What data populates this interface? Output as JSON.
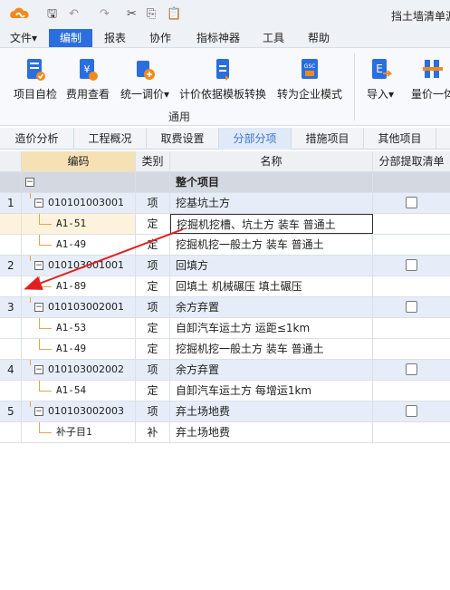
{
  "window": {
    "title": "挡土墙清单源"
  },
  "quick_access": {
    "save": "🖫",
    "undo": "↶",
    "redo": "↷",
    "cut": "✂",
    "copy": "⎘",
    "paste": "📋"
  },
  "menu": [
    "文件",
    "编制",
    "报表",
    "协作",
    "指标神器",
    "工具",
    "帮助"
  ],
  "menu_suffix": {
    "file": "▾"
  },
  "ribbon": {
    "buttons": [
      {
        "label": "项目自检",
        "icon": "project-check-icon"
      },
      {
        "label": "费用查看",
        "icon": "cost-view-icon"
      },
      {
        "label": "统一调价",
        "icon": "unified-price-adjust-icon",
        "dropdown": "▾"
      },
      {
        "label": "计价依据模板转换",
        "icon": "template-convert-icon"
      },
      {
        "label": "转为企业模式",
        "icon": "enterprise-mode-icon"
      },
      {
        "label": "导入",
        "icon": "import-icon",
        "dropdown": "▾"
      },
      {
        "label": "量价一体",
        "icon": "quantity-price-icon"
      }
    ],
    "group_label": "通用"
  },
  "tabs": [
    "造价分析",
    "工程概况",
    "取费设置",
    "分部分项",
    "措施项目",
    "其他项目"
  ],
  "active_tab": "分部分项",
  "grid": {
    "headers": {
      "code": "编码",
      "type": "类别",
      "name": "名称",
      "check": "分部提取清单"
    },
    "top_row": {
      "name": "整个项目"
    },
    "rows": [
      {
        "kind": "item",
        "num": "1",
        "code": "010101003001",
        "type": "项",
        "name": "挖基坑土方"
      },
      {
        "kind": "sub",
        "num": "",
        "code": "A1-51",
        "type": "定",
        "name": "挖掘机挖槽、坑土方 装车 普通土",
        "selected": true
      },
      {
        "kind": "sub",
        "num": "",
        "code": "A1-49",
        "type": "定",
        "name": "挖掘机挖一般土方 装车 普通土"
      },
      {
        "kind": "item",
        "num": "2",
        "code": "010103001001",
        "type": "项",
        "name": "回填方"
      },
      {
        "kind": "sub",
        "num": "",
        "code": "A1-89",
        "type": "定",
        "name": "回填土 机械碾压 填土碾压"
      },
      {
        "kind": "item",
        "num": "3",
        "code": "010103002001",
        "type": "项",
        "name": "余方弃置"
      },
      {
        "kind": "sub",
        "num": "",
        "code": "A1-53",
        "type": "定",
        "name": "自卸汽车运土方 运距≤1km"
      },
      {
        "kind": "sub",
        "num": "",
        "code": "A1-49",
        "type": "定",
        "name": "挖掘机挖一般土方 装车 普通土"
      },
      {
        "kind": "item",
        "num": "4",
        "code": "010103002002",
        "type": "项",
        "name": "余方弃置"
      },
      {
        "kind": "sub",
        "num": "",
        "code": "A1-54",
        "type": "定",
        "name": "自卸汽车运土方 每增运1km"
      },
      {
        "kind": "item",
        "num": "5",
        "code": "010103002003",
        "type": "项",
        "name": "弃土场地费"
      },
      {
        "kind": "sub",
        "num": "",
        "code": "补子目1",
        "type": "补",
        "name": "弃土场地费"
      }
    ],
    "expander_symbol": "−",
    "ellipsis": "···"
  },
  "colors": {
    "accent": "#2a6ee0",
    "arrow": "#e02020",
    "header_code_bg": "#f6e1b5"
  }
}
